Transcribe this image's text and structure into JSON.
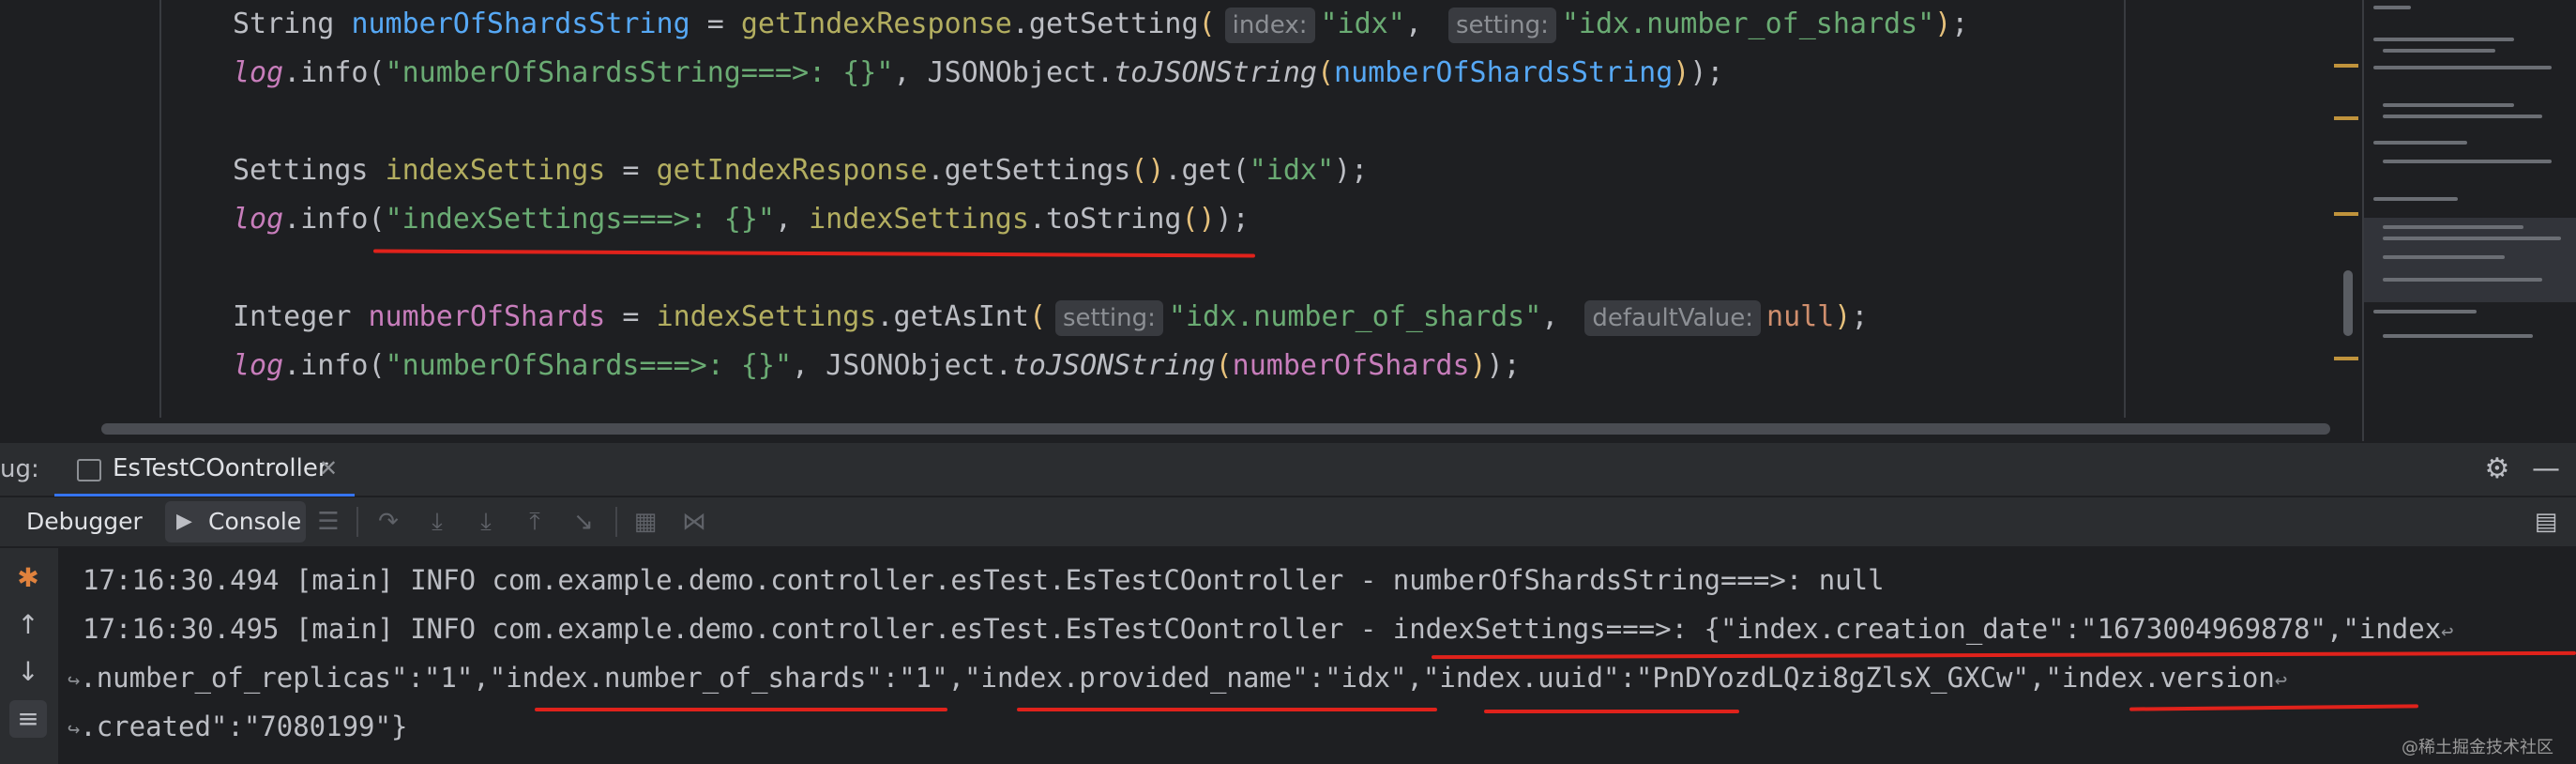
{
  "editor": {
    "lines": [
      {
        "type": "String",
        "var": "numberOfShardsString",
        "obj": "getIndexResponse",
        "method": "getSetting",
        "hint1": "index:",
        "arg1": "\"idx\"",
        "hint2": "setting:",
        "arg2": "\"idx.number_of_shards\""
      },
      {
        "log": "log",
        "info": ".info(",
        "str": "\"numberOfShardsString===>: {}\"",
        "cls": "JSONObject",
        "method": "toJSONString",
        "arg": "numberOfShardsString"
      },
      {
        "type": "Settings",
        "var": "indexSettings",
        "obj": "getIndexResponse",
        "method": "getSettings",
        "get": "get",
        "arg": "\"idx\""
      },
      {
        "log": "log",
        "info": ".info(",
        "str": "\"indexSettings===>: {}\"",
        "obj": "indexSettings",
        "method": "toString"
      },
      {
        "type": "Integer",
        "var": "numberOfShards",
        "obj": "indexSettings",
        "method": "getAsInt",
        "hint1": "setting:",
        "arg1": "\"idx.number_of_shards\"",
        "hint2": "defaultValue:",
        "arg2": "null"
      },
      {
        "log": "log",
        "info": ".info(",
        "str": "\"numberOfShards===>: {}\"",
        "cls": "JSONObject",
        "method": "toJSONString",
        "arg": "numberOfShards"
      }
    ]
  },
  "debug": {
    "label": "ug:",
    "tab_label": "EsTestCOontroller",
    "close": "✕"
  },
  "toolbar": {
    "debugger": "Debugger",
    "console": "Console"
  },
  "console": {
    "line1": "17:16:30.494 [main] INFO com.example.demo.controller.esTest.EsTestCOontroller - numberOfShardsString===>: null",
    "line2": "17:16:30.495 [main] INFO com.example.demo.controller.esTest.EsTestCOontroller - indexSettings===>: {\"index.creation_date\":\"1673004969878\",\"index",
    "line3": ".number_of_replicas\":\"1\",\"index.number_of_shards\":\"1\",\"index.provided_name\":\"idx\",\"index.uuid\":\"PnDYozdLQzi8gZlsX_GXCw\",\"index.version",
    "line4": ".created\":\"7080199\"}"
  },
  "watermark": "@稀土掘金技术社区",
  "colors": {
    "accent": "#3574f0",
    "underline": "#e0221b"
  }
}
